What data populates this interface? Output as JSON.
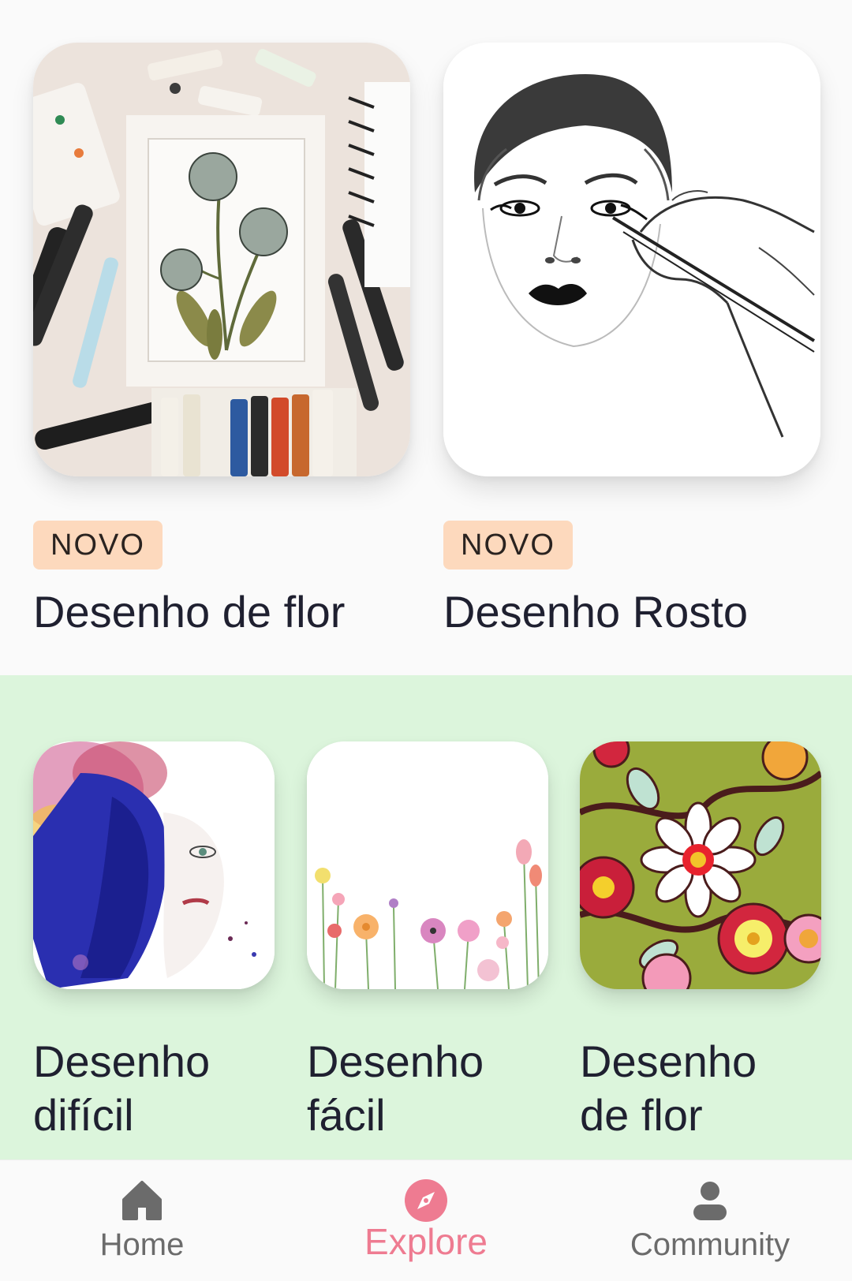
{
  "featured": [
    {
      "badge": "NOVO",
      "title": "Desenho de flor",
      "image": "flower-painting-supplies-image"
    },
    {
      "badge": "NOVO",
      "title": "Desenho Rosto",
      "image": "face-sketch-image"
    }
  ],
  "categories": [
    {
      "title": "Desenho difícil",
      "image": "watercolor-portrait-image"
    },
    {
      "title": "Desenho fácil",
      "image": "wildflower-border-image"
    },
    {
      "title": "Desenho de flor",
      "image": "folk-flower-pattern-image"
    }
  ],
  "nav": {
    "items": [
      {
        "label": "Home",
        "icon": "home-icon",
        "active": false
      },
      {
        "label": "Explore",
        "icon": "compass-icon",
        "active": true
      },
      {
        "label": "Community",
        "icon": "person-icon",
        "active": false
      }
    ]
  },
  "colors": {
    "badge_bg": "#fdd9bd",
    "green_section_bg": "#dcf5dc",
    "active_nav": "#ee7b91",
    "inactive_nav": "#6b6b6b"
  }
}
